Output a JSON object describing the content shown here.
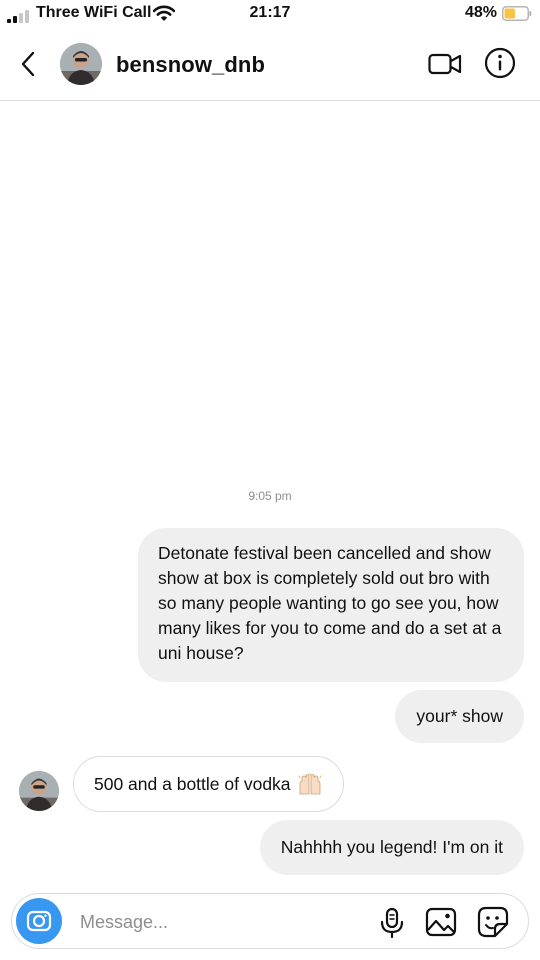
{
  "status_bar": {
    "carrier": "Three WiFi Call",
    "time": "21:17",
    "battery_percent": "48%",
    "battery_level": 0.48,
    "battery_color": "#f6c445",
    "signal_bars": 2
  },
  "header": {
    "username": "bensnow_dnb",
    "icons": [
      "chevron-left-icon",
      "avatar",
      "video-call-icon",
      "info-icon"
    ]
  },
  "conversation": {
    "timestamp": "9:05 pm",
    "messages": [
      {
        "direction": "sent",
        "text": "Detonate festival been cancelled and show show at box is completely sold out bro with so many people wanting to go see you, how many likes for you to come and do a set at a uni house?"
      },
      {
        "direction": "sent",
        "text": "your* show"
      },
      {
        "direction": "received",
        "text": "500 and a bottle of vodka",
        "emoji": "raising-hands-emoji"
      },
      {
        "direction": "sent",
        "text": "Nahhhh you legend! I'm on it"
      }
    ]
  },
  "composer": {
    "placeholder": "Message...",
    "value": "",
    "icons": [
      "camera-icon",
      "microphone-icon",
      "gallery-icon",
      "sticker-icon"
    ],
    "accent": "#3897f0"
  },
  "colors": {
    "sent_bubble": "#efefef",
    "border": "#dbdbdb",
    "muted_text": "#8e8e8e"
  }
}
